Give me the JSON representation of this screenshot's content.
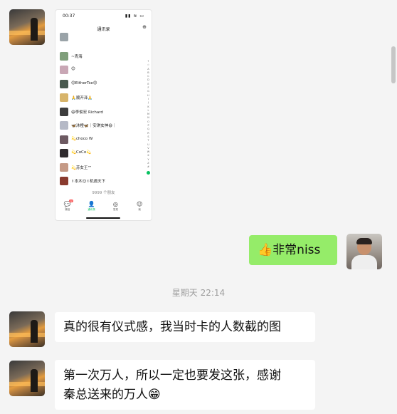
{
  "screenshot": {
    "status_time": "00:37",
    "status_icons": "▮▮ ≋ ▭",
    "title": "通讯录",
    "add_icon": "添加朋友 icon",
    "contacts": [
      {
        "name": "",
        "color": "#9aa3a8"
      },
      {
        "name": "~青海",
        "color": "#7f9e7a"
      },
      {
        "name": "😊",
        "color": "#c9a7b5"
      },
      {
        "name": "😊EitherTse😊",
        "color": "#4a5a4f"
      },
      {
        "name": "🙏顺开泽🙏",
        "color": "#d7b46a"
      },
      {
        "name": "😄李俊宏 Richard",
        "color": "#3d3d3d"
      },
      {
        "name": "🦋沐橙🦋｜安琪女神😄｜",
        "color": "#b5b9c6"
      },
      {
        "name": "💫choco W",
        "color": "#6d5a62"
      },
      {
        "name": "💫CoCo💫",
        "color": "#2f2b2e"
      },
      {
        "name": "💫苏女王™",
        "color": "#c59a86"
      },
      {
        "name": "✌本木☺✌机遇天下",
        "color": "#8a3b2e"
      }
    ],
    "alphabet": "↑\n☆\nA\nB\nC\nD\nE\nF\nG\nH\nI\nJ\nK\nL\nM\nN\nO\nP\nQ\nR\nS\nT\nU\nV\nW\nX\nY\nZ\n#",
    "friend_count": "9999 个朋友",
    "tabs": [
      {
        "label": "微信",
        "icon": "💬",
        "badge": "12"
      },
      {
        "label": "通讯录",
        "icon": "👤",
        "badge": ""
      },
      {
        "label": "发现",
        "icon": "◎",
        "badge": ""
      },
      {
        "label": "我",
        "icon": "☺",
        "badge": ""
      }
    ]
  },
  "messages": {
    "outgoing_1": "👍非常niss",
    "timestamp": "星期天 22:14",
    "incoming_1": "真的很有仪式感，我当时卡的人数截的图",
    "incoming_2_line1": "第一次万人，所以一定也要发这张，感谢",
    "incoming_2_line2": "秦总送来的万人😁"
  },
  "colors": {
    "chat_bg": "#f4f4f4",
    "self_bubble": "#95ec69",
    "other_bubble": "#ffffff",
    "wechat_green": "#07c160"
  }
}
